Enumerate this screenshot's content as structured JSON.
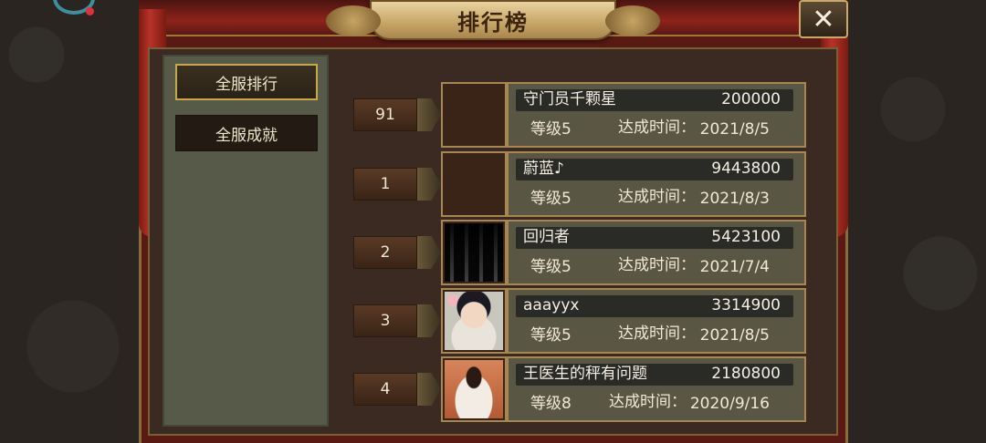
{
  "header": {
    "title": "排行榜",
    "close_label": "✕"
  },
  "sidebar": {
    "tabs": [
      {
        "label": "全服排行",
        "active": true
      },
      {
        "label": "全服成就",
        "active": false
      }
    ]
  },
  "ranking": {
    "time_label": "达成时间：",
    "rows": [
      {
        "rank": "91",
        "name": "守门员千颗星",
        "score": "200000",
        "level": "等级5",
        "time": "2021/8/5",
        "avatar": "empty"
      },
      {
        "rank": "1",
        "name": "蔚蓝♪",
        "score": "9443800",
        "level": "等级5",
        "time": "2021/8/3",
        "avatar": "empty"
      },
      {
        "rank": "2",
        "name": "回归者",
        "score": "5423100",
        "level": "等级5",
        "time": "2021/7/4",
        "avatar": "pillars-photo"
      },
      {
        "rank": "3",
        "name": "aaayyx",
        "score": "3314900",
        "level": "等级5",
        "time": "2021/8/5",
        "avatar": "anime-character"
      },
      {
        "rank": "4",
        "name": "王医生的秤有问题",
        "score": "2180800",
        "level": "等级8",
        "time": "2020/9/16",
        "avatar": "bride-photo"
      }
    ]
  }
}
